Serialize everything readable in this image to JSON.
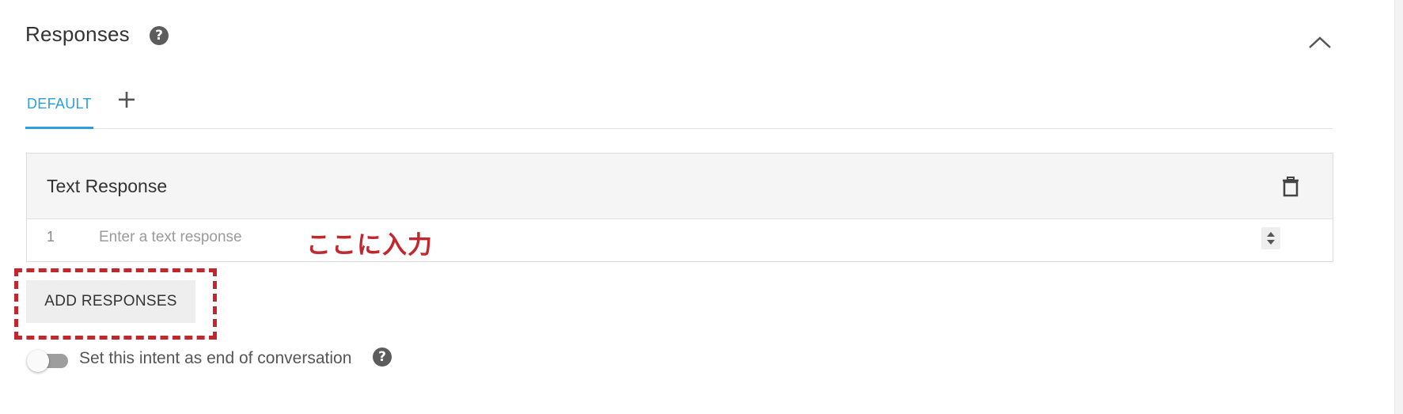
{
  "section": {
    "title": "Responses",
    "help_icon": "help-circle-icon",
    "collapse_icon": "chevron-up-icon"
  },
  "tabs": {
    "items": [
      {
        "label": "DEFAULT",
        "active": true
      }
    ],
    "add_icon": "plus-icon",
    "add_label": "+"
  },
  "text_response_card": {
    "title": "Text Response",
    "delete_icon": "trash-icon",
    "rows": [
      {
        "number": "1",
        "value": "",
        "placeholder": "Enter a text response"
      }
    ],
    "stepper_icon": "sort-arrows-icon"
  },
  "annotation": {
    "text": "ここに入力",
    "color": "#c0282d"
  },
  "add_responses_label": "ADD RESPONSES",
  "end_conversation": {
    "label": "Set this intent as end of conversation",
    "enabled": false,
    "help_icon": "help-circle-icon"
  },
  "colors": {
    "accent": "#2a9fe0",
    "annotation": "#c0282d"
  }
}
